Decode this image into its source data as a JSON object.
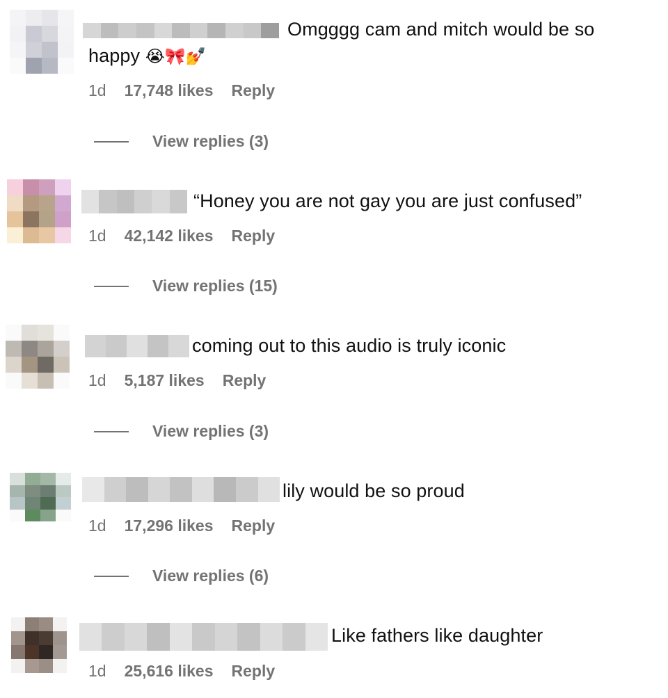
{
  "comments": [
    {
      "text_line1": "Omgggg cam and mitch would be so",
      "text_line2": "happy",
      "emoji": "😭🎀💅",
      "age": "1d",
      "likes": "17,748 likes",
      "reply": "Reply",
      "view_replies": "View replies (3)"
    },
    {
      "text": "“Honey you are not gay you are just confused”",
      "age": "1d",
      "likes": "42,142 likes",
      "reply": "Reply",
      "view_replies": "View replies (15)"
    },
    {
      "text": "coming out to this audio is truly iconic",
      "age": "1d",
      "likes": "5,187 likes",
      "reply": "Reply",
      "view_replies": "View replies (3)"
    },
    {
      "text": "lily would be so proud",
      "age": "1d",
      "likes": "17,296 likes",
      "reply": "Reply",
      "view_replies": "View replies (6)"
    },
    {
      "text": "Like fathers like daughter",
      "age": "1d",
      "likes": "25,616 likes",
      "reply": "Reply"
    }
  ],
  "colors": {
    "text": "#111111",
    "secondary": "#737373",
    "background": "#ffffff"
  }
}
